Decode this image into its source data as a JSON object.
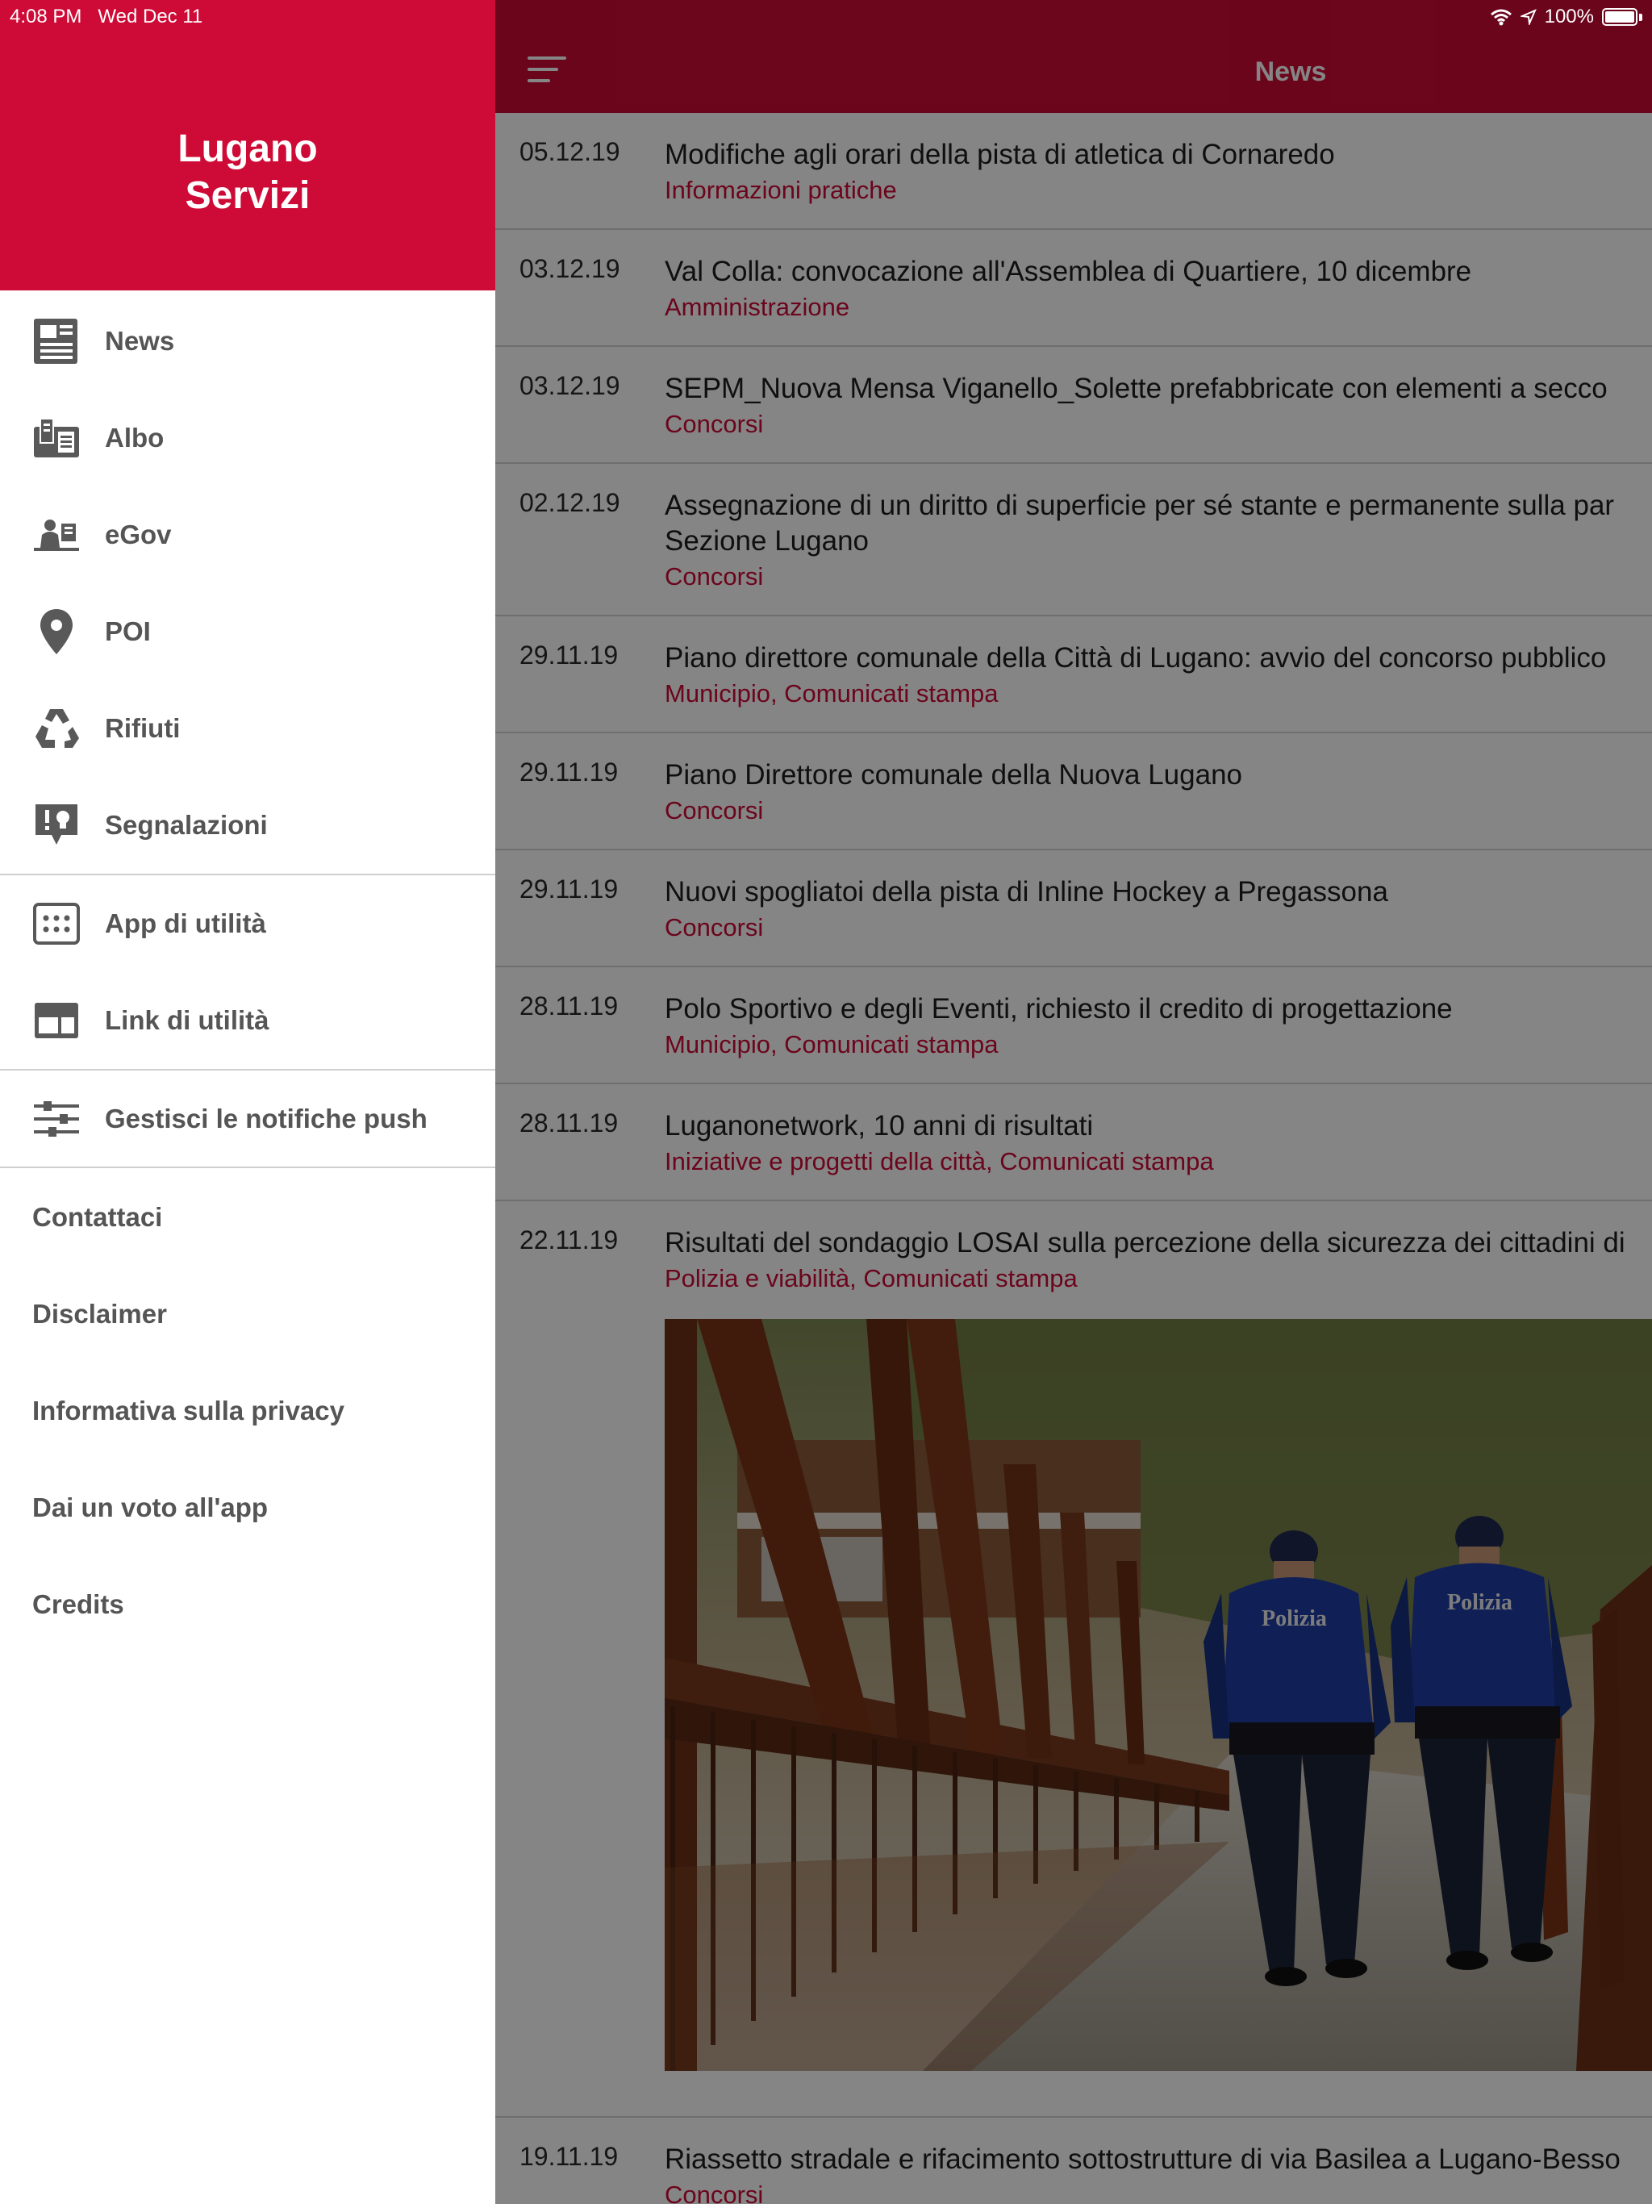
{
  "status": {
    "time": "4:08 PM",
    "date": "Wed Dec 11",
    "battery": "100%"
  },
  "colors": {
    "brand_red": "#ce0b36",
    "category_red": "#ce0b36"
  },
  "drawer": {
    "title_line1": "Lugano",
    "title_line2": "Servizi",
    "items": [
      {
        "label": "News",
        "icon": "newspaper-icon"
      },
      {
        "label": "Albo",
        "icon": "albo-documents-icon"
      },
      {
        "label": "eGov",
        "icon": "egov-desk-icon"
      },
      {
        "label": "POI",
        "icon": "map-pin-icon"
      },
      {
        "label": "Rifiuti",
        "icon": "recycle-icon"
      },
      {
        "label": "Segnalazioni",
        "icon": "report-bulb-icon"
      }
    ],
    "utility_items": [
      {
        "label": "App di utilità",
        "icon": "apps-grid-icon"
      },
      {
        "label": "Link di utilità",
        "icon": "link-window-icon"
      }
    ],
    "push_item": {
      "label": "Gestisci le notifiche push",
      "icon": "sliders-icon"
    },
    "links": [
      "Contattaci",
      "Disclaimer",
      "Informativa sulla privacy",
      "Dai un voto all'app",
      "Credits"
    ]
  },
  "header": {
    "title": "News",
    "menu_icon": "hamburger-menu-icon"
  },
  "news": [
    {
      "date": "05.12.19",
      "title": "Modifiche agli orari della pista di atletica di Cornaredo",
      "category": "Informazioni pratiche"
    },
    {
      "date": "03.12.19",
      "title": "Val Colla: convocazione all'Assemblea di Quartiere, 10 dicembre",
      "category": "Amministrazione"
    },
    {
      "date": "03.12.19",
      "title": "SEPM_Nuova Mensa Viganello_Solette prefabbricate con elementi a secco",
      "category": "Concorsi"
    },
    {
      "date": "02.12.19",
      "title": "Assegnazione di un diritto di superficie per sé stante e permanente sulla par",
      "title2": "Sezione Lugano",
      "category": "Concorsi"
    },
    {
      "date": "29.11.19",
      "title": "Piano direttore comunale della Città di Lugano: avvio del concorso pubblico",
      "category": "Municipio, Comunicati stampa"
    },
    {
      "date": "29.11.19",
      "title": "Piano Direttore comunale della Nuova Lugano",
      "category": "Concorsi"
    },
    {
      "date": "29.11.19",
      "title": "Nuovi spogliatoi della pista di Inline Hockey a Pregassona",
      "category": "Concorsi"
    },
    {
      "date": "28.11.19",
      "title": "Polo Sportivo e degli Eventi, richiesto il credito di progettazione",
      "category": "Municipio, Comunicati stampa"
    },
    {
      "date": "28.11.19",
      "title": "Luganonetwork, 10 anni di risultati",
      "category": "Iniziative e progetti della città, Comunicati stampa"
    },
    {
      "date": "22.11.19",
      "title": "Risultati del sondaggio LOSAI sulla percezione della sicurezza dei cittadini di",
      "category": "Polizia e viabilità, Comunicati stampa",
      "image_badge_left": "Polizia",
      "image_badge_right": "Polizia"
    },
    {
      "date": "19.11.19",
      "title": "Riassetto stradale e rifacimento sottostrutture di via Basilea a Lugano-Besso",
      "category": "Concorsi"
    }
  ]
}
